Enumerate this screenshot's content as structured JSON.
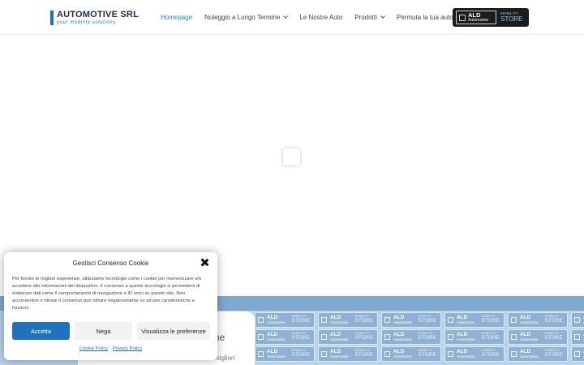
{
  "header": {
    "logo": {
      "title": "AUTOMOTIVE SRL",
      "tagline": "your mobility solutions"
    },
    "nav": [
      {
        "label": "Homepage",
        "active": true,
        "dropdown": false
      },
      {
        "label": "Noleggio a Lungo Termine",
        "active": false,
        "dropdown": true
      },
      {
        "label": "Le Nostre Auto",
        "active": false,
        "dropdown": false
      },
      {
        "label": "Prodotti",
        "active": false,
        "dropdown": true
      },
      {
        "label": "Permuta la tua auto",
        "active": false,
        "dropdown": false
      }
    ],
    "badge": {
      "brand": "ALD",
      "sub": "Automotive",
      "mobility": "MOBILITY",
      "store": "STORE"
    }
  },
  "banner": {
    "tile": {
      "brand": "ALD",
      "sub": "Automotive",
      "mobility": "MOBILITY",
      "store": "STORE"
    },
    "card_title": "ne",
    "card_sub": "migliori"
  },
  "cookie": {
    "title": "Gestisci Consenso Cookie",
    "text": "Per fornire le migliori esperienze, utilizziamo tecnologie come i cookie per memorizzare e/o accedere alle informazioni del dispositivo. Il consenso a queste tecnologie ci permetterà di elaborare dati come il comportamento di navigazione o ID unici su questo sito. Non acconsentire o ritirare il consenso può influire negativamente su alcune caratteristiche e funzioni.",
    "accept": "Accetta",
    "deny": "Nega",
    "preferences": "Visualizza le preferenze",
    "links": [
      "Cookie Policy",
      "Privacy Policy"
    ]
  },
  "colors": {
    "accent": "#1e73be",
    "nav_active": "#1e88c9",
    "banner": "#b8d3ea",
    "badge_bg": "#1c1c1c"
  }
}
